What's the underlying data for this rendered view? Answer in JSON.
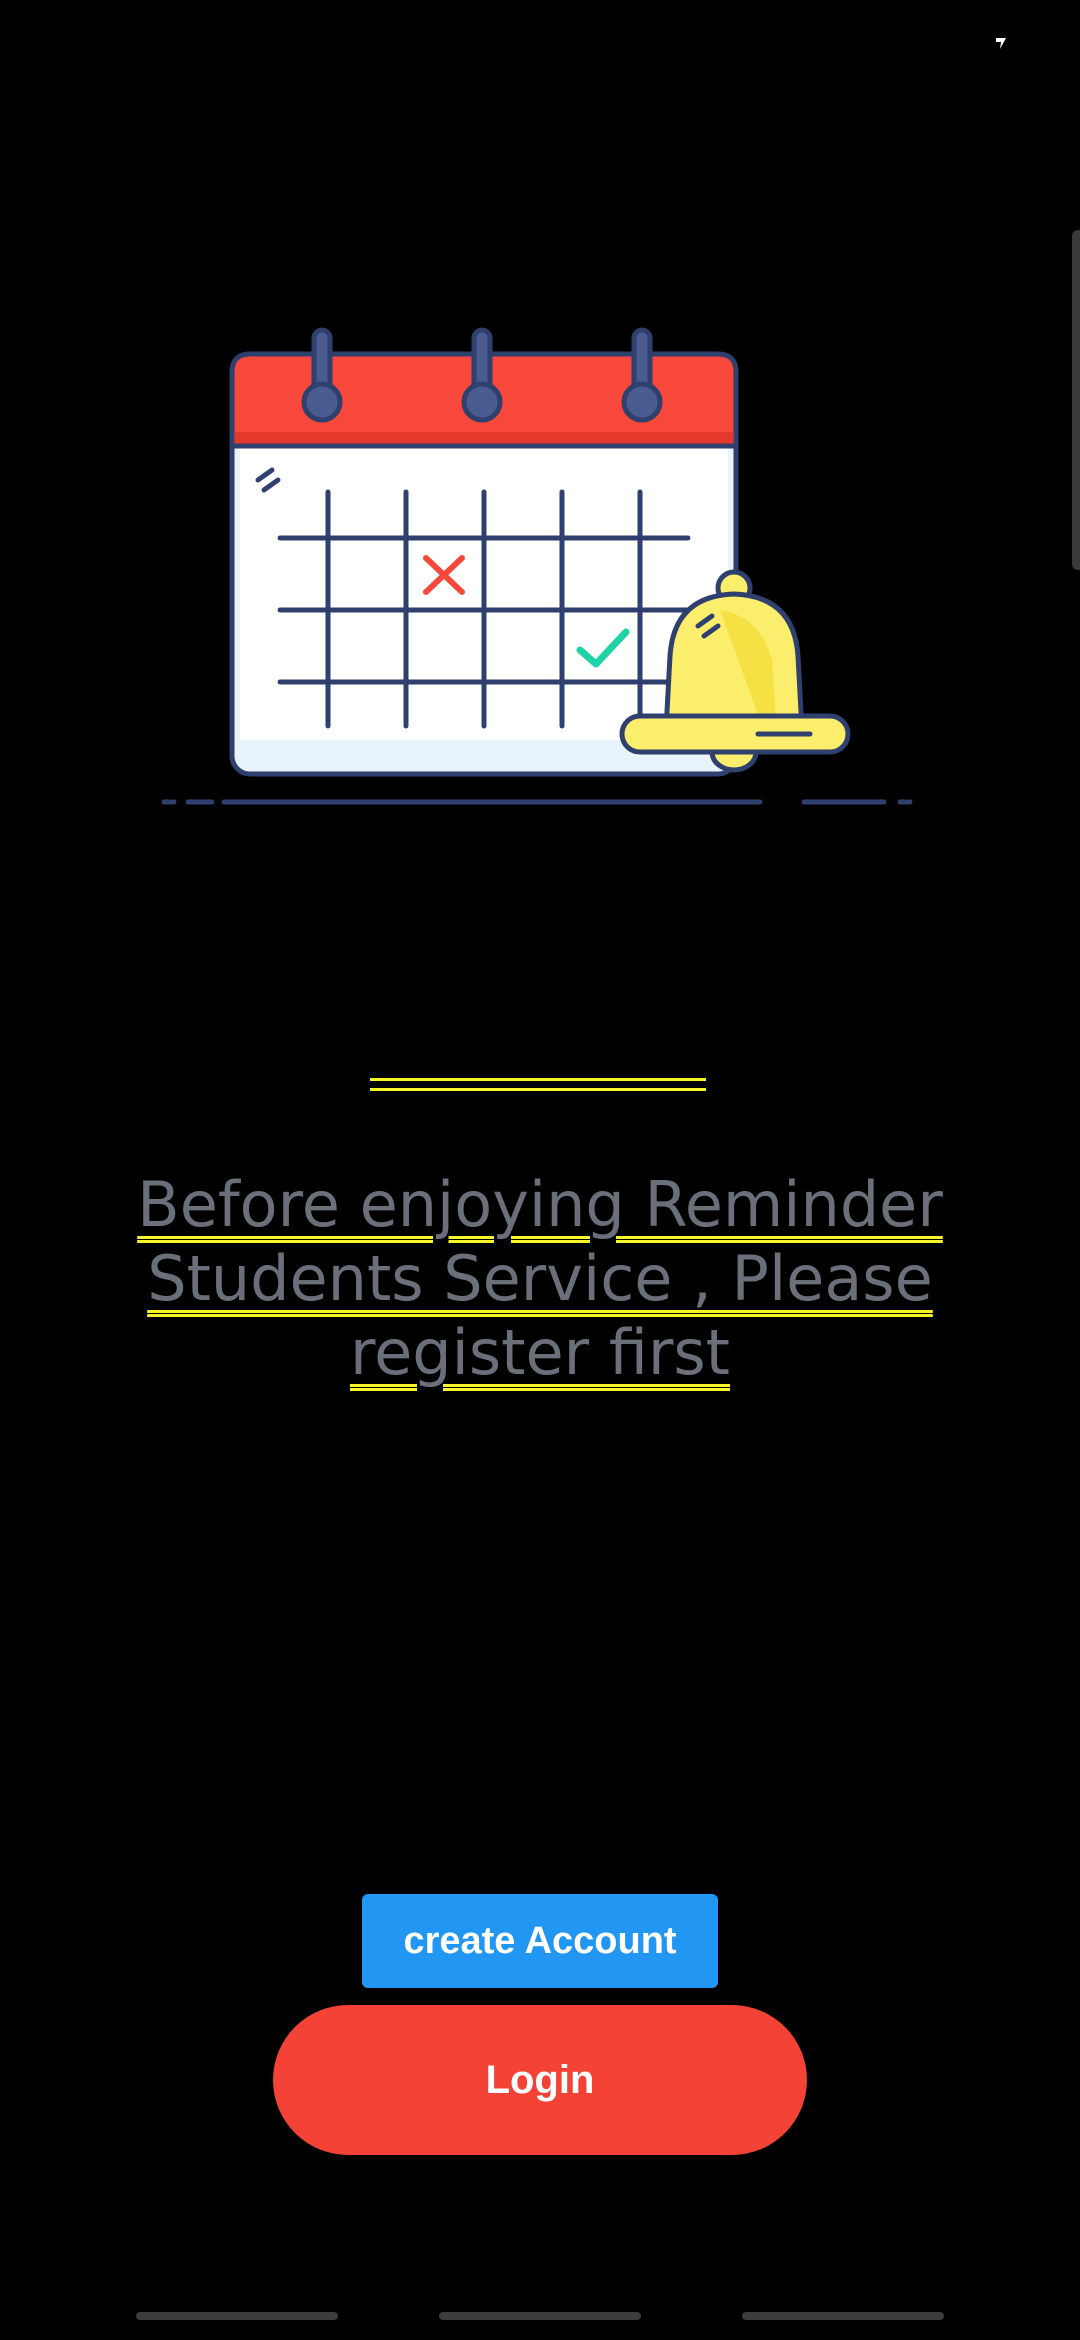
{
  "message": {
    "line1": "Before enjoying Reminder",
    "line2": "Students Service , Please",
    "line3": "register first"
  },
  "buttons": {
    "create_account": "create Account",
    "login": "Login"
  },
  "colors": {
    "background": "#000000",
    "message_text": "#6b6f7a",
    "underline_accent": "#f5f52a",
    "create_button": "#2196f3",
    "login_button": "#f44336",
    "calendar_header": "#f7483b",
    "bell": "#fbee6c"
  },
  "icons": {
    "status": "signal-icon",
    "illustration": "calendar-bell-illustration"
  }
}
